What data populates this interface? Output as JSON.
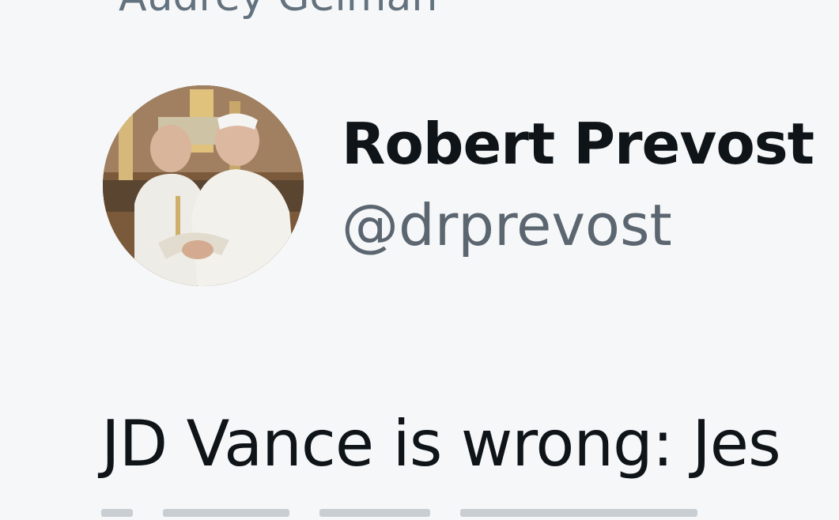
{
  "screenshot": {
    "attribution_name": "Audrey Gelman"
  },
  "tweet": {
    "author": {
      "display_name": "Robert Prevost",
      "handle": "@drprevost",
      "avatar_icon": "profile-photo-two-clergy-embracing"
    },
    "text": "JD Vance is wrong: Jes"
  },
  "colors": {
    "background": "#f6f7f8",
    "name_text": "#0f1419",
    "handle_text": "#5b6670"
  }
}
